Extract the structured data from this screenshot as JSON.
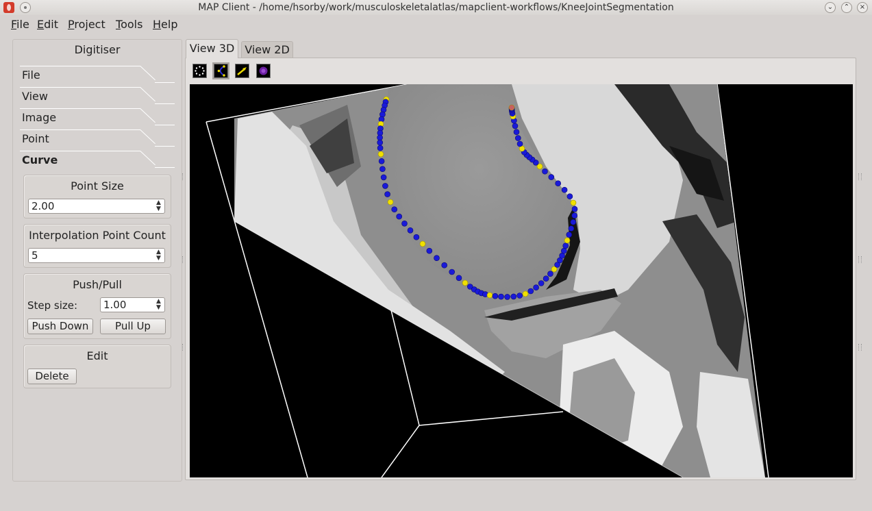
{
  "window": {
    "title": "MAP Client - /home/hsorby/work/musculoskeletalatlas/mapclient-workflows/KneeJointSegmentation"
  },
  "menu": {
    "items": [
      {
        "label": "File",
        "ul": "F",
        "rest": "ile"
      },
      {
        "label": "Edit",
        "ul": "E",
        "rest": "dit"
      },
      {
        "label": "Project",
        "ul": "P",
        "rest": "roject"
      },
      {
        "label": "Tools",
        "ul": "T",
        "rest": "ools"
      },
      {
        "label": "Help",
        "ul": "H",
        "rest": "elp"
      }
    ]
  },
  "digitiser": {
    "title": "Digitiser",
    "sections": [
      "File",
      "View",
      "Image",
      "Point",
      "Curve"
    ],
    "active_section": "Curve",
    "point_size": {
      "title": "Point Size",
      "value": "2.00"
    },
    "interp": {
      "title": "Interpolation Point Count",
      "value": "5"
    },
    "pushpull": {
      "title": "Push/Pull",
      "step_label": "Step size:",
      "step_value": "1.00",
      "push_label": "Push Down",
      "pull_label": "Pull Up"
    },
    "edit": {
      "title": "Edit",
      "delete_label": "Delete"
    }
  },
  "tabs": [
    {
      "label": "View 3D",
      "active": true
    },
    {
      "label": "View 2D",
      "active": false
    }
  ],
  "toolbar": {
    "tools": [
      "point-tool-icon",
      "curve-tool-icon",
      "normal-tool-icon",
      "orientation-tool-icon"
    ],
    "selected": "curve-tool-icon"
  }
}
